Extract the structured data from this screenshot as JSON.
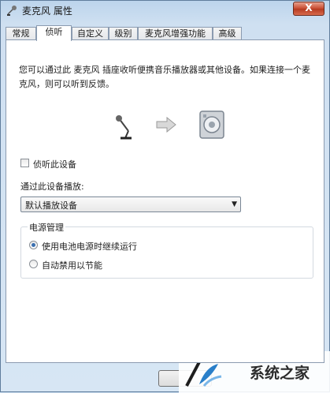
{
  "window": {
    "title": "麦克风 属性",
    "close_label": "X"
  },
  "tabs": [
    {
      "label": "常规"
    },
    {
      "label": "侦听"
    },
    {
      "label": "自定义"
    },
    {
      "label": "级别"
    },
    {
      "label": "麦克风增强功能"
    },
    {
      "label": "高级"
    }
  ],
  "active_tab": "侦听",
  "listen": {
    "description": "您可以通过此 麦克风 插座收听便携音乐播放器或其他设备。如果连接一个麦克风，则可以听到反馈。",
    "checkbox_label": "侦听此设备",
    "checkbox_checked": false,
    "playback_label": "通过此设备播放:",
    "playback_value": "默认播放设备"
  },
  "power": {
    "group_title": "电源管理",
    "options": [
      {
        "label": "使用电池电源时继续运行",
        "checked": true
      },
      {
        "label": "自动禁用以节能",
        "checked": false
      }
    ]
  },
  "watermark": {
    "text": "系统之家"
  },
  "icons": {
    "title": "microphone-icon",
    "source": "microphone-icon",
    "arrow": "arrow-right-icon",
    "target": "speaker-icon"
  },
  "colors": {
    "accent_radio": "#3a6fb0",
    "title_gradient": "#bcd4ec",
    "close_button": "#c74a2f"
  }
}
